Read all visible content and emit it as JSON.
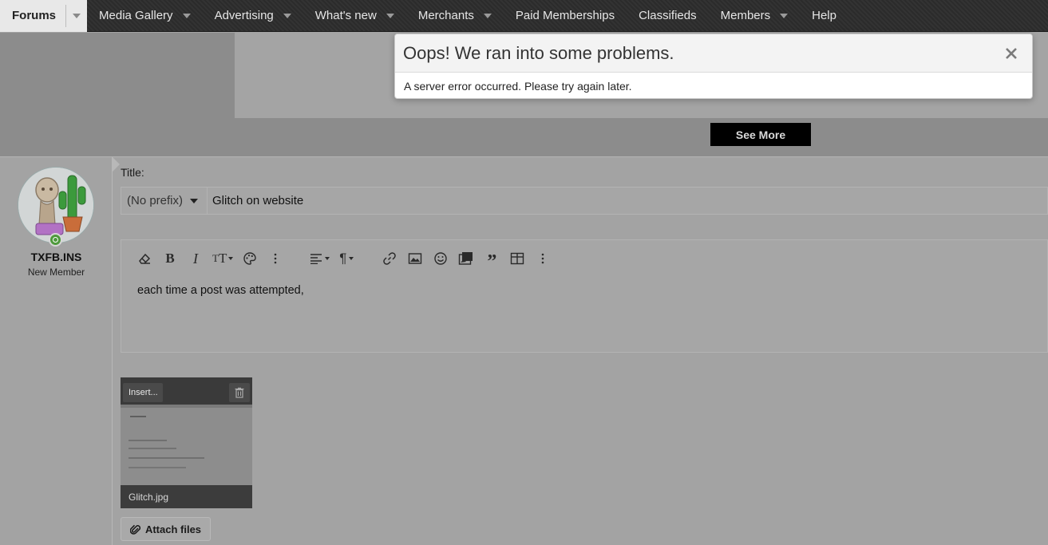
{
  "nav": {
    "items": [
      {
        "label": "Forums",
        "active": true,
        "dropdown": true
      },
      {
        "label": "Media Gallery",
        "dropdown": true
      },
      {
        "label": "Advertising",
        "dropdown": true
      },
      {
        "label": "What's new",
        "dropdown": true
      },
      {
        "label": "Merchants",
        "dropdown": true
      },
      {
        "label": "Paid Memberships",
        "dropdown": false
      },
      {
        "label": "Classifieds",
        "dropdown": false
      },
      {
        "label": "Members",
        "dropdown": true
      },
      {
        "label": "Help",
        "dropdown": false
      }
    ]
  },
  "banner": {
    "button_label": "See More"
  },
  "error": {
    "title": "Oops! We ran into some problems.",
    "message": "A server error occurred. Please try again later.",
    "close_icon": "close-icon"
  },
  "user": {
    "name": "TXFB.INS",
    "title": "New Member"
  },
  "form": {
    "title_label": "Title:",
    "prefix_value": "(No prefix)",
    "title_value": "Glitch on website",
    "body_text": "each time a post was attempted,"
  },
  "toolbar": {
    "buttons": [
      "eraser-icon",
      "bold-icon",
      "italic-icon",
      "text-size-icon",
      "palette-icon",
      "more-vertical-icon",
      "align-icon",
      "paragraph-icon",
      "link-icon",
      "image-icon",
      "smiley-icon",
      "media-icon",
      "quote-icon",
      "table-icon",
      "more-vertical-icon"
    ]
  },
  "attachment": {
    "filename": "Glitch.jpg",
    "insert_label": "Insert...",
    "attach_label": "Attach files"
  },
  "colors": {
    "overlay_dim": "#a3a3a3",
    "nav_bg": "#2e2e2e",
    "online": "#4e9a3c"
  }
}
